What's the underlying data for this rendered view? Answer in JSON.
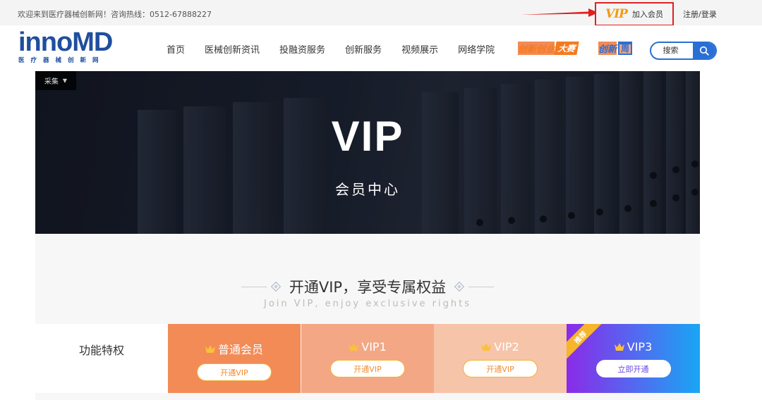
{
  "topbar": {
    "welcome": "欢迎来到医疗器械创新网！咨询热线：0512-67888227",
    "vip_logo": "VIP",
    "join_vip": "加入会员",
    "login": "注册/登录"
  },
  "header": {
    "logo_text": "innoMD",
    "logo_sub": "医疗器械创新网",
    "nav": [
      "首页",
      "医械创新资讯",
      "投融资服务",
      "创新服务",
      "视频展示",
      "网络学院"
    ],
    "badge_dasai": {
      "text": "创新创业",
      "tag": "大赛"
    },
    "badge_zhou": {
      "text": "创新",
      "tag": "周"
    },
    "search_placeholder": "搜索"
  },
  "banner": {
    "tag": "采集",
    "title": "VIP",
    "subtitle": "会员中心"
  },
  "section": {
    "title": "开通VIP，享受专属权益",
    "subtitle_en": "Join VIP, enjoy exclusive rights",
    "feature_label": "功能特权",
    "tiers": [
      {
        "name": "普通会员",
        "button": "开通VIP"
      },
      {
        "name": "VIP1",
        "button": "开通VIP"
      },
      {
        "name": "VIP2",
        "button": "开通VIP"
      },
      {
        "name": "VIP3",
        "button": "立即开通",
        "ribbon": "推荐"
      }
    ]
  },
  "colors": {
    "brand_blue": "#1f4e9e",
    "accent_orange": "#f47a1f",
    "highlight_red": "#e02020",
    "tier1": "#f38b56",
    "tier2": "#f4a785",
    "tier3": "#f6c4a9",
    "tier4_gradient": [
      "#8a2be8",
      "#18a6f4"
    ]
  }
}
